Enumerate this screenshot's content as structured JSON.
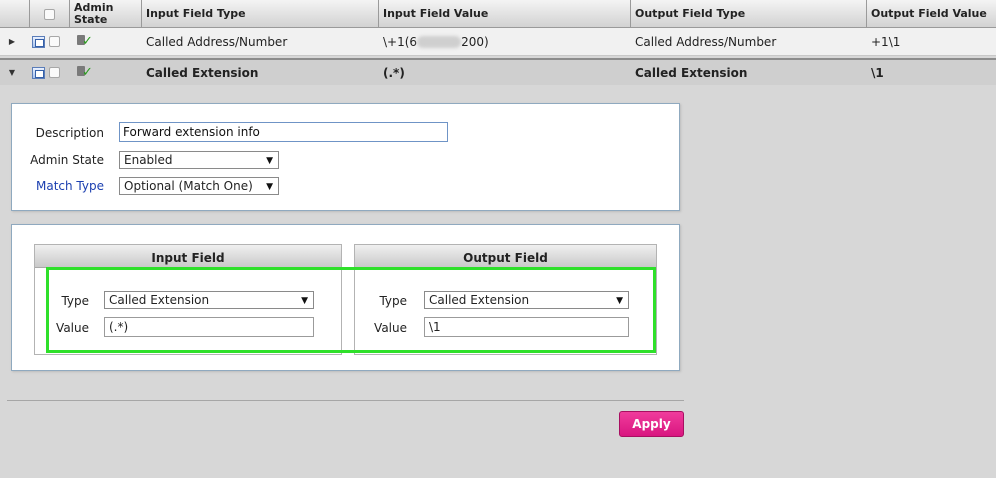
{
  "table": {
    "headers": {
      "admin_state": "Admin State",
      "input_type": "Input Field Type",
      "input_value": "Input Field Value",
      "output_type": "Output Field Type",
      "output_value": "Output Field Value"
    },
    "rows": [
      {
        "expanded": false,
        "input_type": "Called Address/Number",
        "input_value_prefix": "\\+1(6",
        "input_value_suffix": "200)",
        "output_type": "Called Address/Number",
        "output_value": "+1\\1"
      },
      {
        "expanded": true,
        "input_type": "Called Extension",
        "input_value": "(.*)",
        "output_type": "Called Extension",
        "output_value": "\\1"
      }
    ]
  },
  "details": {
    "description_label": "Description",
    "description_value": "Forward extension info",
    "admin_state_label": "Admin State",
    "admin_state_value": "Enabled",
    "match_type_label": "Match Type",
    "match_type_value": "Optional (Match One)"
  },
  "input_field": {
    "title": "Input Field",
    "type_label": "Type",
    "type_value": "Called Extension",
    "value_label": "Value",
    "value": "(.*)"
  },
  "output_field": {
    "title": "Output Field",
    "type_label": "Type",
    "type_value": "Called Extension",
    "value_label": "Value",
    "value": "\\1"
  },
  "apply_label": "Apply",
  "colors": {
    "apply_button": "#e0228a",
    "highlight": "#2ee02a",
    "link": "#1b3fb0"
  }
}
